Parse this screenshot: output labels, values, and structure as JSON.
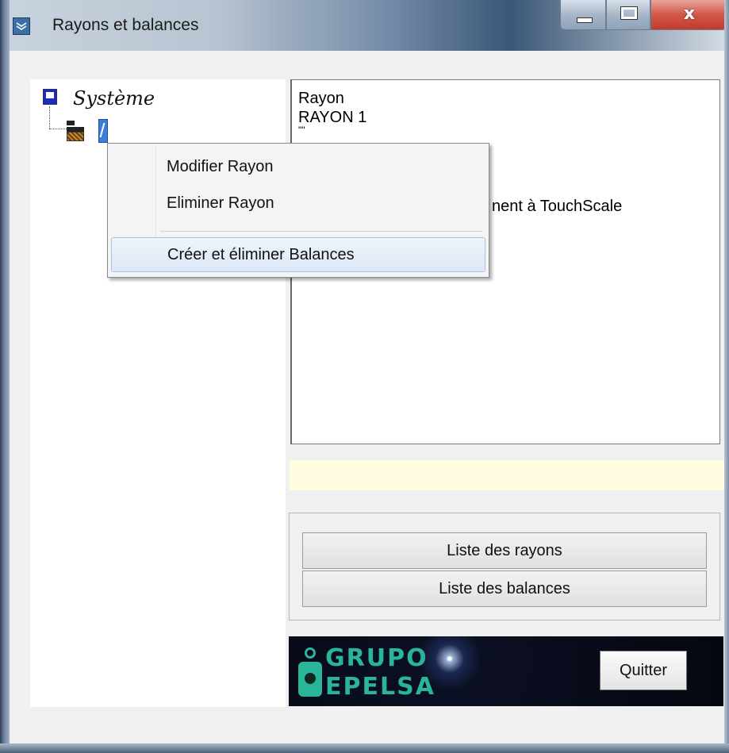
{
  "window": {
    "title": "Rayons et balances",
    "close_glyph": "x"
  },
  "tree": {
    "root_label": "Système",
    "root_icon": "computer-icon",
    "child_icon": "department-icon"
  },
  "info": {
    "lines": [
      "Rayon",
      "RAYON 1",
      "\"\"",
      "",
      "",
      "nent à TouchScale"
    ]
  },
  "buttons": {
    "list_rayons": "Liste des rayons",
    "list_balances": "Liste des balances",
    "quit": "Quitter"
  },
  "brand": {
    "line1": "GRUPO",
    "line2": "EPELSA"
  },
  "context_menu": {
    "items": [
      {
        "label": "Modifier Rayon"
      },
      {
        "label": "Eliminer Rayon"
      },
      {
        "label": "Créer et éliminer Balances",
        "highlighted": true
      }
    ]
  },
  "colors": {
    "brand_accent": "#2bb598",
    "status_bar": "#fffce0",
    "menu_highlight": "#dce8f6"
  }
}
